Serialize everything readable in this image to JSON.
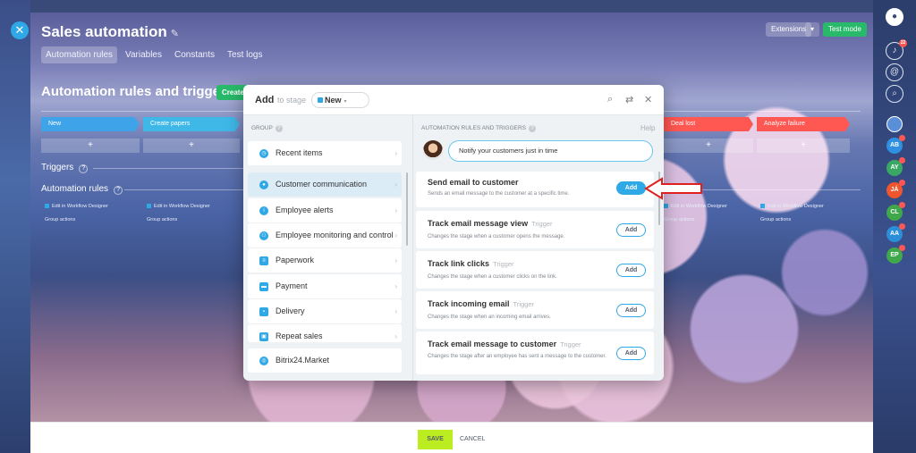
{
  "page": {
    "title": "Sales automation",
    "tabs": [
      "Automation rules",
      "Variables",
      "Constants",
      "Test logs"
    ],
    "extensions_label": "Extensions",
    "test_mode_label": "Test mode",
    "heading": "Automation rules and triggers",
    "create_label": "Create",
    "stages": [
      {
        "label": "New",
        "color": "#3fa3e9"
      },
      {
        "label": "Create papers",
        "color": "#3fb8e8"
      },
      {
        "label": "Deal lost",
        "color": "#ff5752"
      },
      {
        "label": "Analyze failure",
        "color": "#ff5752"
      }
    ],
    "plus_label": "+",
    "triggers_label": "Triggers",
    "automation_rules_label": "Automation rules",
    "edit_link_label": "Edit in Workflow Designer",
    "group_actions_label": "Group actions",
    "footer": {
      "save": "SAVE",
      "cancel": "CANCEL"
    }
  },
  "dialog": {
    "title": "Add",
    "to_stage": "to stage",
    "stage": "New",
    "group_label": "GROUP",
    "rules_label": "AUTOMATION RULES AND TRIGGERS",
    "help": "Help",
    "bubble": "Notify your customers just in time",
    "groups": [
      {
        "label": "Recent items",
        "icon": "clock-icon",
        "color": "#2fa8e6"
      },
      {
        "label": "Customer communication",
        "icon": "chat-icon",
        "color": "#2fa8e6"
      },
      {
        "label": "Employee alerts",
        "icon": "info-icon",
        "color": "#2fa8e6"
      },
      {
        "label": "Employee monitoring and control",
        "icon": "people-icon",
        "color": "#2fa8e6"
      },
      {
        "label": "Paperwork",
        "icon": "document-icon",
        "color": "#2fa8e6"
      },
      {
        "label": "Payment",
        "icon": "wallet-icon",
        "color": "#2fa8e6"
      },
      {
        "label": "Delivery",
        "icon": "truck-icon",
        "color": "#2fa8e6"
      },
      {
        "label": "Repeat sales",
        "icon": "cart-icon",
        "color": "#2fa8e6"
      }
    ],
    "market": {
      "label": "Bitrix24.Market",
      "icon": "market-icon"
    },
    "rules": [
      {
        "title": "Send email to customer",
        "trigger": "",
        "desc": "Sends an email message to the customer at a specific time.",
        "add": "Add"
      },
      {
        "title": "Track email message view",
        "trigger": "Trigger",
        "desc": "Changes the stage when a customer opens the message.",
        "add": "Add"
      },
      {
        "title": "Track link clicks",
        "trigger": "Trigger",
        "desc": "Changes the stage when a customer clicks on the link.",
        "add": "Add"
      },
      {
        "title": "Track incoming email",
        "trigger": "Trigger",
        "desc": "Changes the stage when an incoming email arrives.",
        "add": "Add"
      },
      {
        "title": "Track email message to customer",
        "trigger": "Trigger",
        "desc": "Changes the stage after an employee has sent a message to the customer.",
        "add": "Add"
      }
    ]
  },
  "right_bar": {
    "notification_count": "22",
    "avatars": [
      {
        "initials": "AB",
        "color": "#2f8fe0"
      },
      {
        "initials": "AY",
        "color": "#3aa865"
      },
      {
        "initials": "JÁ",
        "color": "#f0562e"
      },
      {
        "initials": "CL",
        "color": "#3fa84a"
      },
      {
        "initials": "AA",
        "color": "#2a8ed8"
      },
      {
        "initials": "EP",
        "color": "#3fa84a"
      }
    ]
  }
}
